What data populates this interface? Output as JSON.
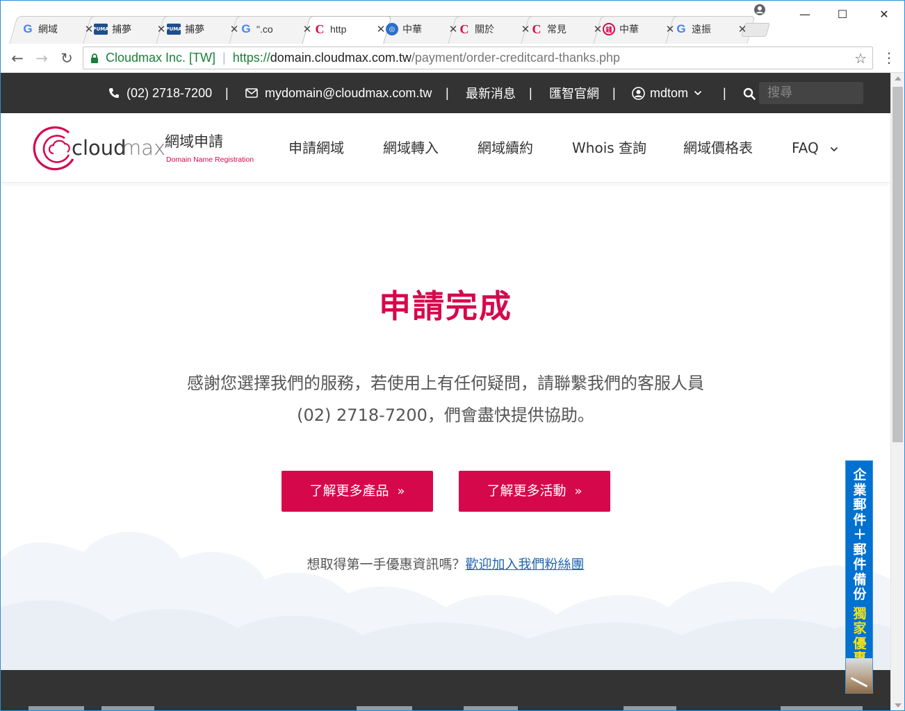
{
  "browser": {
    "tabs": [
      {
        "title": "網域",
        "favicon": "google-g-icon",
        "active": false
      },
      {
        "title": "捕夢",
        "favicon": "puma-icon",
        "active": false
      },
      {
        "title": "捕夢",
        "favicon": "puma-icon",
        "active": false
      },
      {
        "title": "\".co",
        "favicon": "google-g-icon",
        "active": false
      },
      {
        "title": "http",
        "favicon": "cloudmax-c-icon",
        "active": true
      },
      {
        "title": "中華",
        "favicon": "globe-icon",
        "active": false
      },
      {
        "title": "關於",
        "favicon": "cloudmax-c-icon",
        "active": false
      },
      {
        "title": "常見",
        "favicon": "cloudmax-c-icon",
        "active": false
      },
      {
        "title": "中華",
        "favicon": "seal-icon",
        "active": false
      },
      {
        "title": "遠振",
        "favicon": "google-g-icon",
        "active": false
      }
    ],
    "secure_label": "Cloudmax Inc. [TW]",
    "url_scheme": "https://",
    "url_host": "domain.cloudmax.com.tw",
    "url_path": "/payment/order-creditcard-thanks.php"
  },
  "topbar": {
    "phone": "(02) 2718-7200",
    "email": "mydomain@cloudmax.com.tw",
    "news": "最新消息",
    "official_site": "匯智官網",
    "user": "mdtom",
    "separator": "|",
    "search_placeholder": "搜尋"
  },
  "logo": {
    "brand_a": "cloud",
    "brand_b": "max",
    "service": "網域申請",
    "tagline": "Domain Name Registration"
  },
  "nav": {
    "items": [
      "申請網域",
      "網域轉入",
      "網域續約",
      "Whois 查詢",
      "網域價格表",
      "FAQ"
    ]
  },
  "main": {
    "title": "申請完成",
    "message_line1": "感謝您選擇我們的服務，若使用上有任何疑問，請聯繫我們的客服人員",
    "message_line2": "(02) 2718-7200，們會盡快提供協助。",
    "button_products": "了解更多產品",
    "button_events": "了解更多活動",
    "fans_prompt": "想取得第一手優惠資訊嗎？",
    "fans_link": "歡迎加入我們粉絲團"
  },
  "side_banner": {
    "text_white": "企業郵件＋郵件備份",
    "text_gold": "獨家優惠"
  },
  "colors": {
    "brand_red": "#d6084c",
    "topbar_bg": "#333333",
    "link_blue": "#2466b0",
    "banner_blue": "#0071d0",
    "banner_gold": "#f4e21b"
  }
}
